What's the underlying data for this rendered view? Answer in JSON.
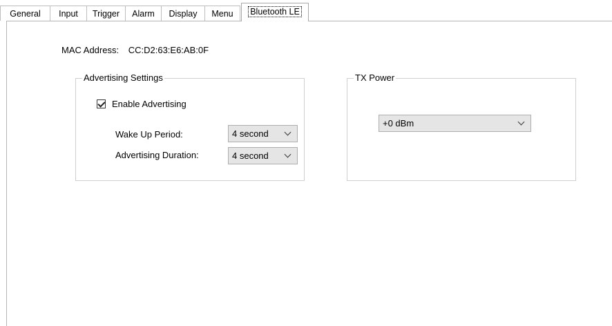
{
  "tabs": [
    {
      "label": "General"
    },
    {
      "label": "Input"
    },
    {
      "label": "Trigger"
    },
    {
      "label": "Alarm"
    },
    {
      "label": "Display"
    },
    {
      "label": "Menu"
    },
    {
      "label": "Bluetooth LE",
      "selected": true
    }
  ],
  "mac": {
    "label": "MAC Address:",
    "value": "CC:D2:63:E6:AB:0F"
  },
  "advertising": {
    "group_title": "Advertising Settings",
    "enable_label": "Enable Advertising",
    "enable_checked": true,
    "wake_up_label": "Wake Up Period:",
    "wake_up_value": "4 second",
    "duration_label": "Advertising Duration:",
    "duration_value": "4 second"
  },
  "tx_power": {
    "group_title": "TX Power",
    "value": "+0 dBm"
  },
  "icons": {
    "checkbox": "checkmark-icon",
    "dropdown": "chevron-down-icon"
  },
  "colors": {
    "background": "#ffffff",
    "combo_background": "#e5e5e5",
    "border": "#adadad"
  }
}
